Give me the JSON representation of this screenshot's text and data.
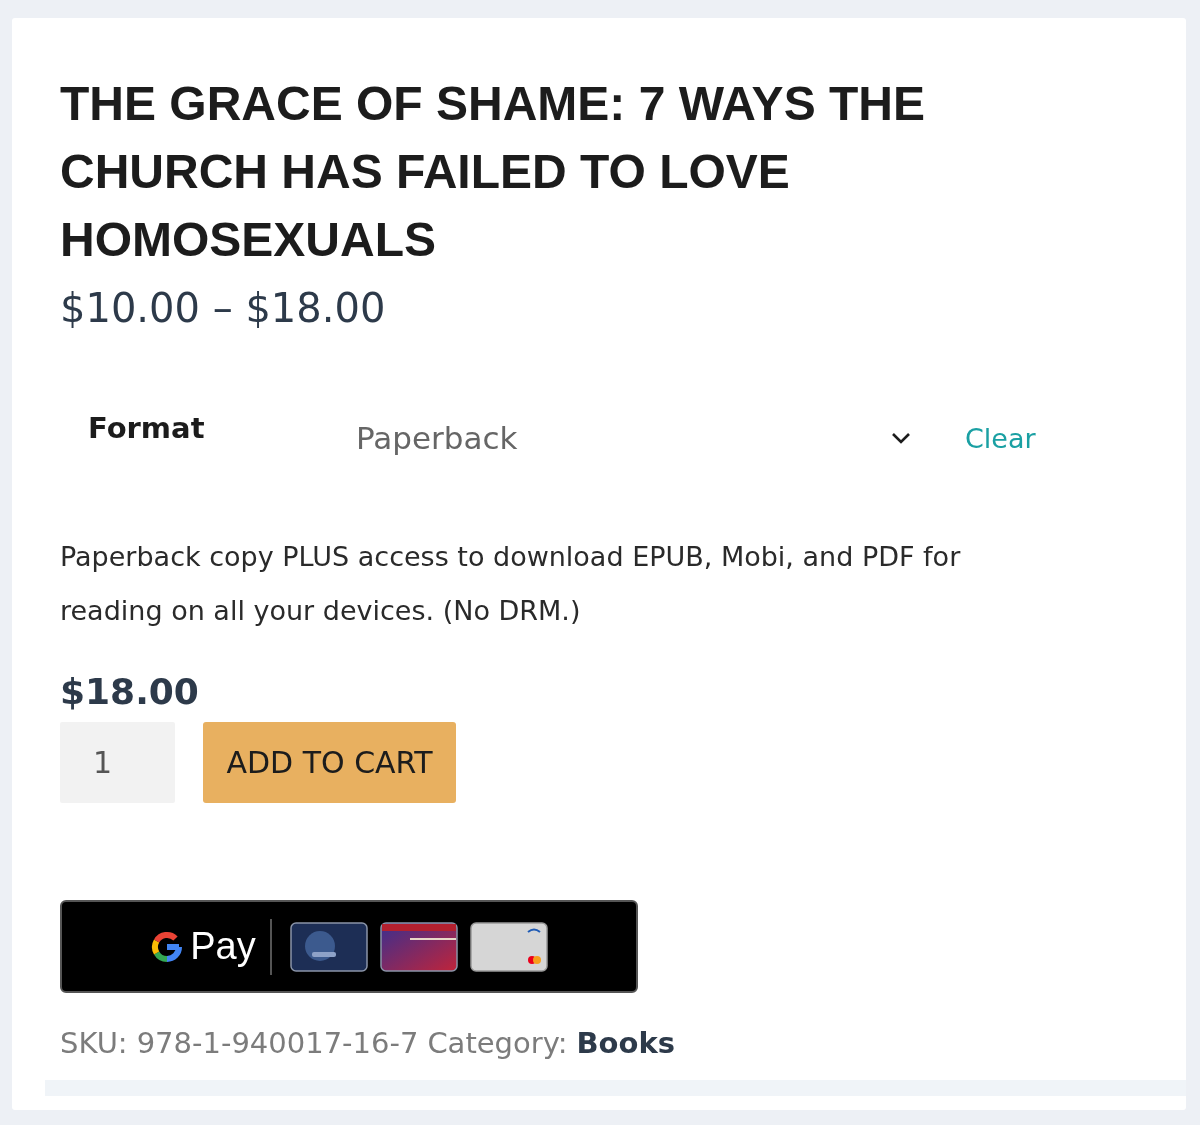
{
  "product": {
    "title": "THE GRACE OF SHAME: 7 WAYS THE CHURCH HAS FAILED TO LOVE HOMOSEXUALS",
    "price_range": "$10.00 – $18.00"
  },
  "variation": {
    "label": "Format",
    "value": "Paperback",
    "clear": "Clear"
  },
  "description": "Paperback copy PLUS access to download EPUB, Mobi, and PDF for reading on all your devices. (No DRM.)",
  "price": "$18.00",
  "quantity": {
    "value": "1"
  },
  "add_to_cart": "ADD TO CART",
  "gpay": {
    "label": "Pay"
  },
  "meta": {
    "sku_label": "SKU:",
    "sku": "978-1-940017-16-7",
    "category_label": "Category:",
    "category": "Books"
  }
}
